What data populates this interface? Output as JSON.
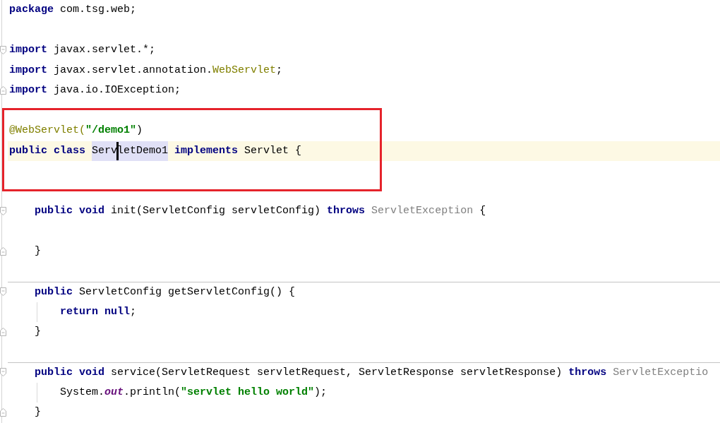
{
  "lines": [
    {
      "kind": "code",
      "current": false,
      "framed": false,
      "tokens": [
        {
          "kind": "keyword",
          "text": "package"
        },
        {
          "kind": "plain",
          "text": " com.tsg.web;"
        }
      ]
    },
    {
      "kind": "blank",
      "current": false,
      "framed": false
    },
    {
      "kind": "code",
      "current": false,
      "framed": false,
      "fold_marker": {
        "kind": "start"
      },
      "tokens": [
        {
          "kind": "keyword",
          "text": "import"
        },
        {
          "kind": "plain",
          "text": " javax.servlet.*;"
        }
      ]
    },
    {
      "kind": "code",
      "current": false,
      "framed": false,
      "tokens": [
        {
          "kind": "keyword",
          "text": "import"
        },
        {
          "kind": "plain",
          "text": " javax.servlet.annotation."
        },
        {
          "kind": "annotation",
          "text": "WebServlet"
        },
        {
          "kind": "plain",
          "text": ";"
        }
      ]
    },
    {
      "kind": "code",
      "current": false,
      "framed": false,
      "fold_marker": {
        "kind": "end"
      },
      "tokens": [
        {
          "kind": "keyword",
          "text": "import"
        },
        {
          "kind": "plain",
          "text": " java.io.IOException;"
        }
      ]
    },
    {
      "kind": "blank",
      "current": false,
      "framed": false
    },
    {
      "kind": "code",
      "current": false,
      "framed": true,
      "tokens": [
        {
          "kind": "annotation",
          "text": "@WebServlet("
        },
        {
          "kind": "string",
          "text": "\"/demo1\""
        },
        {
          "kind": "plain",
          "text": ")"
        }
      ]
    },
    {
      "kind": "code",
      "current": true,
      "framed": true,
      "tokens": [
        {
          "kind": "keyword",
          "text": "public class ",
          "highlighted": false
        },
        {
          "kind": "plain",
          "text": "Serv",
          "highlighted": true
        },
        {
          "kind": "plain",
          "text": "letDemo1",
          "highlighted": true,
          "caret": true
        },
        {
          "kind": "keyword",
          "text": " implements",
          "highlighted": false
        },
        {
          "kind": "plain",
          "text": " Servlet {",
          "highlighted": false
        }
      ],
      "children": [
        {
          "kind": "blank",
          "current": false,
          "separator": false
        },
        {
          "kind": "blank",
          "current": false,
          "separator": false
        },
        {
          "kind": "code",
          "current": false,
          "separator": false,
          "fold_marker": {
            "kind": "start"
          },
          "tokens": [
            {
              "kind": "keyword",
              "text": "public void"
            },
            {
              "kind": "plain",
              "text": " init(ServletConfig servletConfig) "
            },
            {
              "kind": "keyword",
              "text": "throws"
            },
            {
              "kind": "muted",
              "text": " ServletException"
            },
            {
              "kind": "plain",
              "text": " {"
            }
          ],
          "children": [
            {
              "kind": "blank",
              "current": false
            }
          ]
        },
        {
          "kind": "code",
          "current": false,
          "separator": false,
          "fold_marker": {
            "kind": "end"
          },
          "tokens": [
            {
              "kind": "plain",
              "text": "}"
            }
          ]
        },
        {
          "kind": "blank",
          "current": false,
          "separator": false
        },
        {
          "kind": "code",
          "current": false,
          "separator": true,
          "fold_marker": {
            "kind": "start"
          },
          "tokens": [
            {
              "kind": "keyword",
              "text": "public"
            },
            {
              "kind": "plain",
              "text": " ServletConfig getServletConfig() {"
            }
          ],
          "children": [
            {
              "kind": "code",
              "current": false,
              "tokens": [
                {
                  "kind": "keyword",
                  "text": "return null"
                },
                {
                  "kind": "plain",
                  "text": ";"
                }
              ]
            }
          ]
        },
        {
          "kind": "code",
          "current": false,
          "separator": false,
          "fold_marker": {
            "kind": "end"
          },
          "tokens": [
            {
              "kind": "plain",
              "text": "}"
            }
          ]
        },
        {
          "kind": "blank",
          "current": false,
          "separator": false
        },
        {
          "kind": "code",
          "current": false,
          "separator": true,
          "fold_marker": {
            "kind": "start"
          },
          "tokens": [
            {
              "kind": "keyword",
              "text": "public void"
            },
            {
              "kind": "plain",
              "text": " service(ServletRequest servletRequest, ServletResponse servletResponse) "
            },
            {
              "kind": "keyword",
              "text": "throws"
            },
            {
              "kind": "muted",
              "text": " ServletExceptio"
            }
          ],
          "children": [
            {
              "kind": "code",
              "current": false,
              "tokens": [
                {
                  "kind": "plain",
                  "text": "System."
                },
                {
                  "kind": "field",
                  "text": "out"
                },
                {
                  "kind": "plain",
                  "text": ".println("
                },
                {
                  "kind": "string",
                  "text": "\"servlet hello world\""
                },
                {
                  "kind": "plain",
                  "text": ");"
                }
              ]
            }
          ]
        },
        {
          "kind": "code",
          "current": false,
          "separator": false,
          "fold_marker": {
            "kind": "end"
          },
          "tokens": [
            {
              "kind": "plain",
              "text": "}"
            }
          ]
        }
      ]
    }
  ]
}
